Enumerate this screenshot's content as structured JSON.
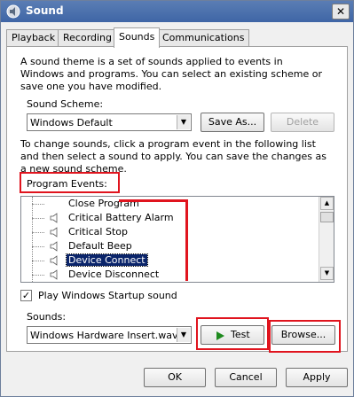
{
  "window": {
    "title": "Sound",
    "close_glyph": "✕"
  },
  "tabs": [
    "Playback",
    "Recording",
    "Sounds",
    "Communications"
  ],
  "active_tab": "Sounds",
  "intro_text": "A sound theme is a set of sounds applied to events in Windows and programs.  You can select an existing scheme or save one you have modified.",
  "sound_scheme": {
    "label": "Sound Scheme:",
    "value": "Windows Default",
    "save_as_label": "Save As...",
    "delete_label": "Delete"
  },
  "events_text": "To change sounds, click a program event in the following list and then select a sound to apply.  You can save the changes as a new sound scheme.",
  "program_events": {
    "label": "Program Events:",
    "items": [
      "Close Program",
      "Critical Battery Alarm",
      "Critical Stop",
      "Default Beep",
      "Device Connect",
      "Device Disconnect"
    ],
    "selected": "Device Connect"
  },
  "startup_sound": {
    "label": "Play Windows Startup sound",
    "checked": true,
    "check_glyph": "✓"
  },
  "sounds": {
    "label": "Sounds:",
    "value": "Windows Hardware Insert.wav",
    "test_label": "Test",
    "browse_label": "Browse..."
  },
  "footer": {
    "ok_label": "OK",
    "cancel_label": "Cancel",
    "apply_label": "Apply"
  },
  "icons": {
    "app": "speaker-app-icon",
    "event": "speaker-icon",
    "dropdown": "chevron-down-icon",
    "play": "play-icon"
  },
  "colors": {
    "titlebar": "#4a70ae",
    "selection": "#0a246a",
    "highlight": "#e0141e",
    "play_green": "#1e8a1e"
  }
}
